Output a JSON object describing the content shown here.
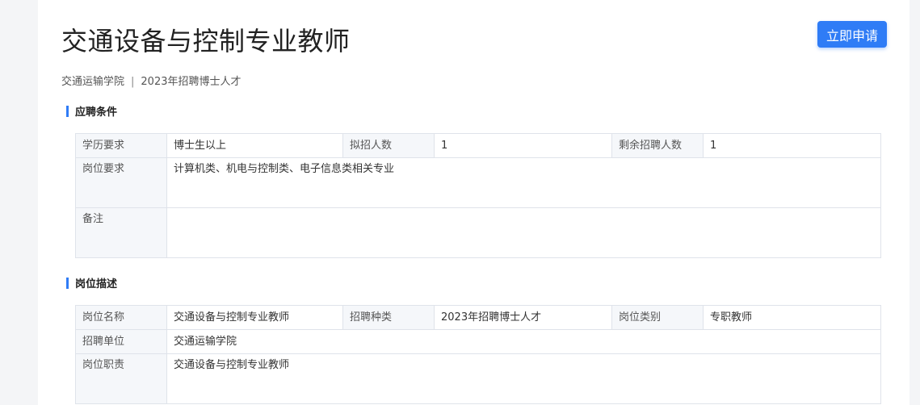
{
  "header": {
    "title": "交通设备与控制专业教师",
    "apply_label": "立即申请",
    "college": "交通运输学院",
    "separator": "|",
    "program": "2023年招聘博士人才"
  },
  "requirements": {
    "heading": "应聘条件",
    "degree_label": "学历要求",
    "degree_value": "博士生以上",
    "planned_label": "拟招人数",
    "planned_value": "1",
    "remaining_label": "剩余招聘人数",
    "remaining_value": "1",
    "position_req_label": "岗位要求",
    "position_req_value": "计算机类、机电与控制类、电子信息类相关专业",
    "remark_label": "备注",
    "remark_value": ""
  },
  "description": {
    "heading": "岗位描述",
    "name_label": "岗位名称",
    "name_value": "交通设备与控制专业教师",
    "type_label": "招聘种类",
    "type_value": "2023年招聘博士人才",
    "category_label": "岗位类别",
    "category_value": "专职教师",
    "unit_label": "招聘单位",
    "unit_value": "交通运输学院",
    "duty_label": "岗位职责",
    "duty_value": "交通设备与控制专业教师"
  },
  "colors": {
    "accent": "#2f7cf6",
    "label_bg": "#f5f7fa",
    "border": "#dfe3ea"
  }
}
